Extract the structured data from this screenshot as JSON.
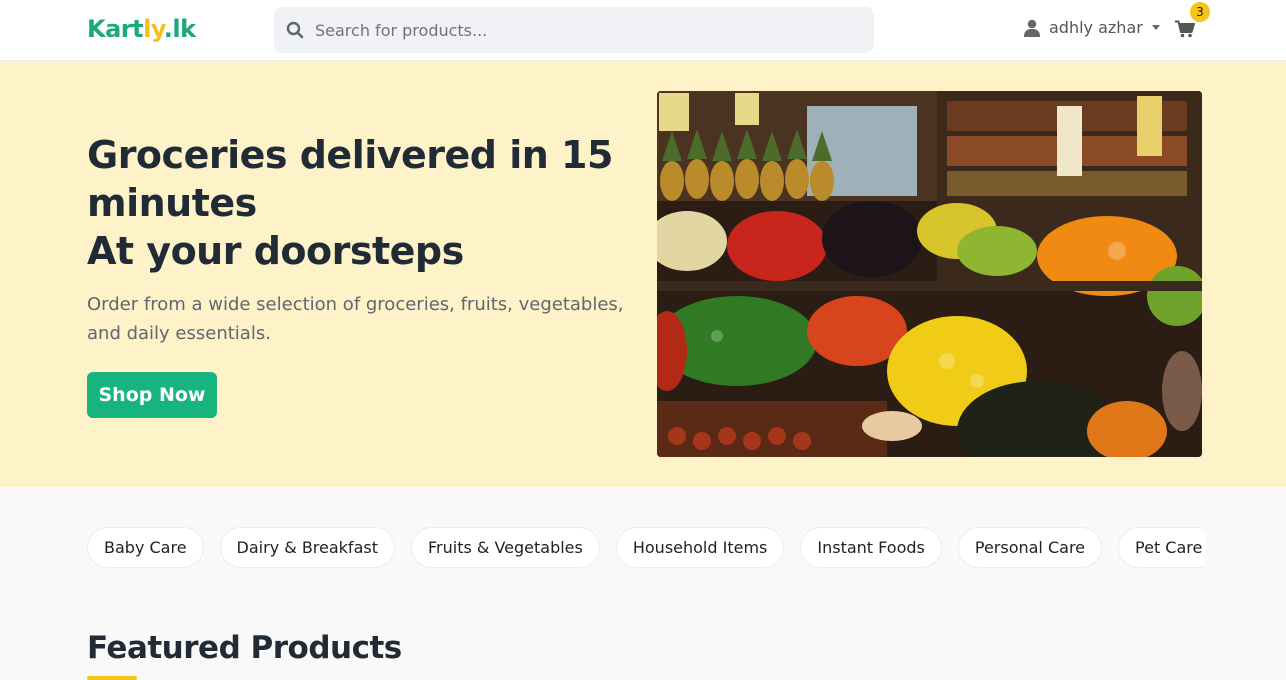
{
  "header": {
    "logo": {
      "part1": "Kart",
      "part2": "ly",
      "part3": ".lk"
    },
    "search_placeholder": "Search for products...",
    "user_name": "adhly azhar",
    "cart_count": "3"
  },
  "hero": {
    "title_line1": "Groceries delivered in 15",
    "title_line2": "minutes",
    "title_line3": "At your doorsteps",
    "subtitle": "Order from a wide selection of groceries, fruits, vegetables, and daily essentials.",
    "cta_label": "Shop Now",
    "image_icon": "grocery-produce-photo"
  },
  "categories": [
    "Baby Care",
    "Dairy & Breakfast",
    "Fruits & Vegetables",
    "Household Items",
    "Instant Foods",
    "Personal Care",
    "Pet Care",
    ""
  ],
  "featured": {
    "title": "Featured Products"
  },
  "colors": {
    "brand_green": "#17b47d",
    "brand_yellow": "#f5c518",
    "hero_bg": "#fef2c9"
  }
}
